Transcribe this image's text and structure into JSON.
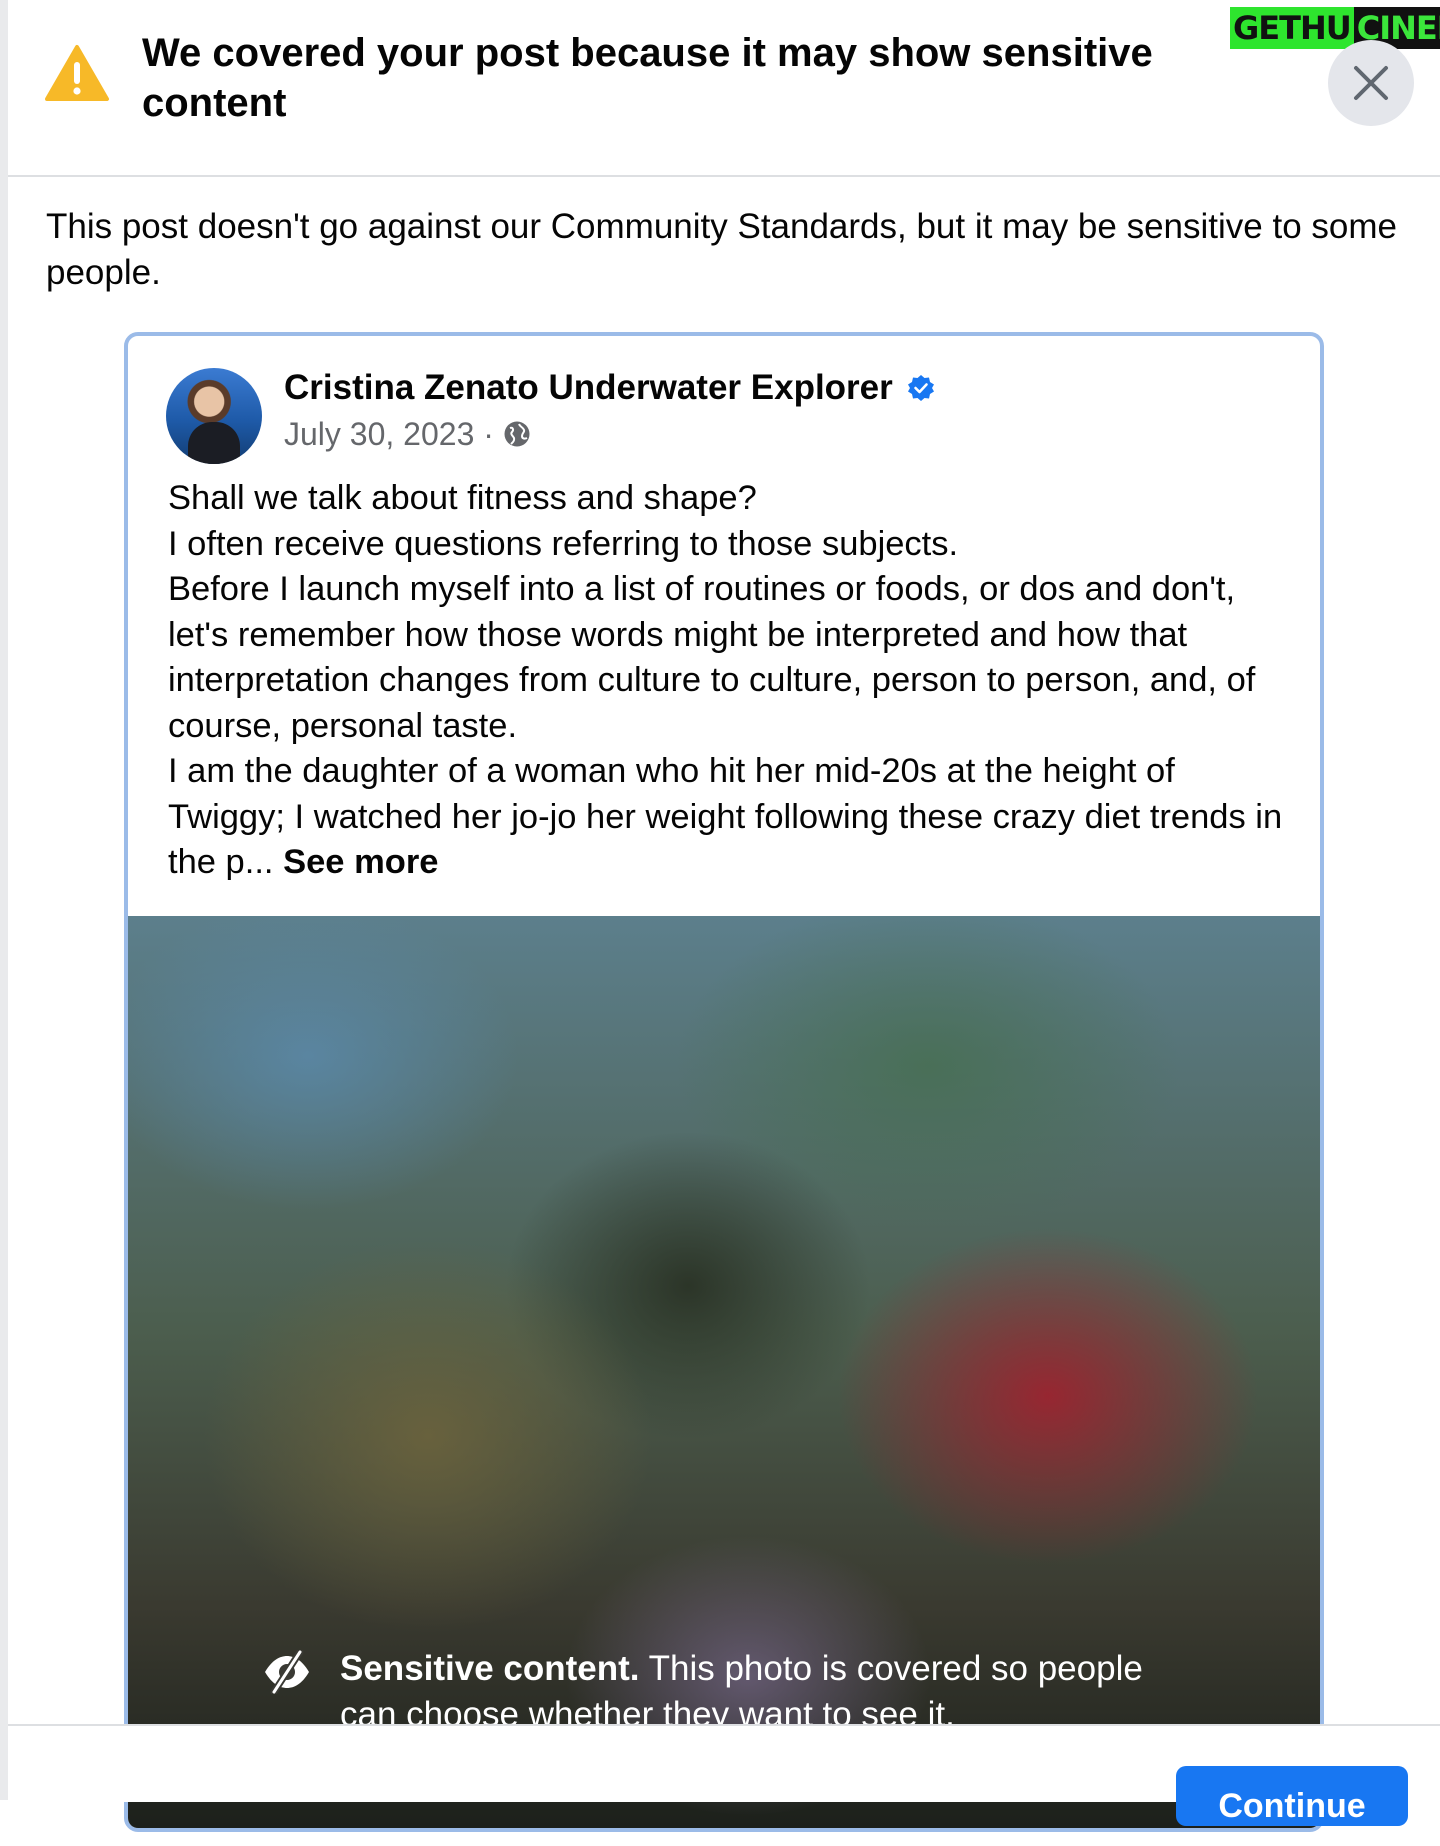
{
  "dialog": {
    "title": "We covered your post because it may show sensitive content",
    "description": "This post doesn't go against our Community Standards, but it may be sensitive to some people.",
    "close_icon": "close-icon",
    "warning_icon": "warning-triangle-icon"
  },
  "watermark": {
    "part1": "GETHU",
    "part2": "CINEMA"
  },
  "post": {
    "author": "Cristina Zenato Underwater Explorer",
    "verified_icon": "verified-badge-icon",
    "date": "July 30, 2023 ·",
    "audience_icon": "globe-icon",
    "lines": [
      "Shall we talk about fitness and shape?",
      "I often receive questions referring to those subjects.",
      "Before I launch myself into a list of routines or foods, or dos and don't, let's remember how those words might be interpreted and how that interpretation changes from culture to culture, person to person, and, of course, personal taste.",
      "I am the daughter of a woman who hit her mid-20s at the height of Twiggy; I watched her jo-jo her weight following these crazy diet trends in the p..."
    ],
    "see_more": "See more"
  },
  "photo_cover": {
    "icon": "eye-slash-icon",
    "title": "Sensitive content.",
    "text": "This photo is covered so people can choose whether they want to see it."
  },
  "footer": {
    "continue_label": "Continue"
  },
  "colors": {
    "warning": "#f7b928",
    "accent": "#1877f2",
    "verified": "#1877f2",
    "card_border": "#9bbbe8"
  }
}
